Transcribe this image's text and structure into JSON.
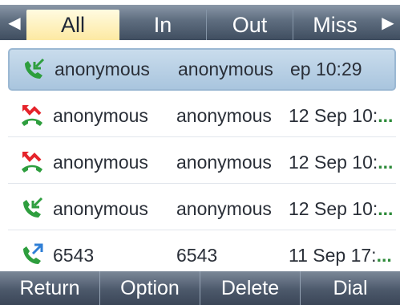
{
  "tabs": [
    {
      "label": "All",
      "active": true
    },
    {
      "label": "In",
      "active": false
    },
    {
      "label": "Out",
      "active": false
    },
    {
      "label": "Miss",
      "active": false
    }
  ],
  "arrows": {
    "left_icon": "triangle-left-icon",
    "right_icon": "triangle-right-icon"
  },
  "calls": [
    {
      "type": "incoming",
      "icon": "incoming-call-icon",
      "name": "anonymous",
      "number": "anonymous",
      "time": "ep 10:29",
      "time_suffix": "",
      "selected": true
    },
    {
      "type": "missed",
      "icon": "missed-call-icon",
      "name": "anonymous",
      "number": "anonymous",
      "time": "12 Sep 10:",
      "time_suffix": "...",
      "selected": false
    },
    {
      "type": "missed",
      "icon": "missed-call-icon",
      "name": "anonymous",
      "number": "anonymous",
      "time": "12 Sep 10:",
      "time_suffix": "...",
      "selected": false
    },
    {
      "type": "incoming",
      "icon": "incoming-call-icon",
      "name": "anonymous",
      "number": "anonymous",
      "time": "12 Sep 10:",
      "time_suffix": "...",
      "selected": false
    },
    {
      "type": "outgoing",
      "icon": "outgoing-call-icon",
      "name": "6543",
      "number": "6543",
      "time": "11 Sep 17:",
      "time_suffix": "...",
      "selected": false
    }
  ],
  "softkeys": [
    {
      "label": "Return"
    },
    {
      "label": "Option"
    },
    {
      "label": "Delete"
    },
    {
      "label": "Dial"
    }
  ],
  "colors": {
    "phone_green": "#2e9e3e",
    "missed_red": "#e5232a",
    "outgoing_blue": "#2f7fd6",
    "selection": "#b5cfe6",
    "active_tab": "#fdf0b8"
  }
}
